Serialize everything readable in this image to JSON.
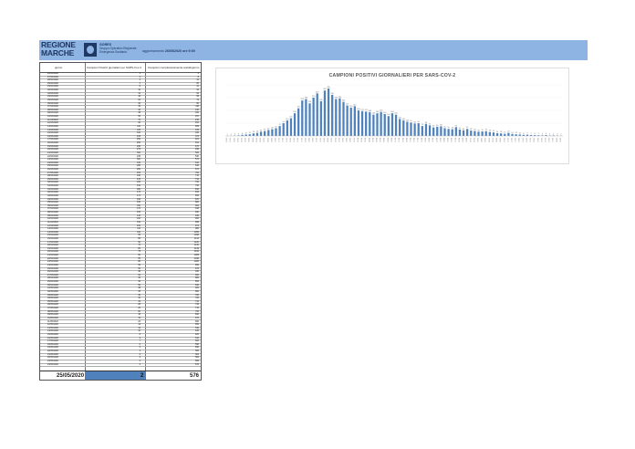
{
  "header": {
    "logo_line1": "REGIONE",
    "logo_line2": "MARCHE",
    "org_line1": "GORES",
    "org_line2": "Gruppo Operativo Regionale",
    "org_line3": "Emergenza Sanitaria",
    "updated_label": "aggiornamento",
    "updated_value": "26/05/2020 ore 9:00"
  },
  "table": {
    "columns": [
      "giorno",
      "Campioni Positivi giornalieri per SARS-Cov-2",
      "Campioni complessivamente testati/giorno"
    ],
    "rows": [
      [
        "26/02/2020",
        "1",
        "3"
      ],
      [
        "27/02/2020",
        "2",
        "8"
      ],
      [
        "28/02/2020",
        "3",
        "12"
      ],
      [
        "29/02/2020",
        "4",
        "20"
      ],
      [
        "01/03/2020",
        "8",
        "31"
      ],
      [
        "02/03/2020",
        "10",
        "43"
      ],
      [
        "03/03/2020",
        "12",
        "52"
      ],
      [
        "04/03/2020",
        "18",
        "68"
      ],
      [
        "05/03/2020",
        "22",
        "79"
      ],
      [
        "06/03/2020",
        "30",
        "95"
      ],
      [
        "07/03/2020",
        "35",
        "118"
      ],
      [
        "08/03/2020",
        "42",
        "130"
      ],
      [
        "09/03/2020",
        "48",
        "160"
      ],
      [
        "10/03/2020",
        "55",
        "197"
      ],
      [
        "11/03/2020",
        "70",
        "210"
      ],
      [
        "12/03/2020",
        "90",
        "252"
      ],
      [
        "13/03/2020",
        "110",
        "289"
      ],
      [
        "14/03/2020",
        "125",
        "315"
      ],
      [
        "15/03/2020",
        "160",
        "340"
      ],
      [
        "16/03/2020",
        "195",
        "372"
      ],
      [
        "17/03/2020",
        "250",
        "421"
      ],
      [
        "18/03/2020",
        "260",
        "452"
      ],
      [
        "19/03/2020",
        "230",
        "470"
      ],
      [
        "20/03/2020",
        "270",
        "498"
      ],
      [
        "21/03/2020",
        "300",
        "520"
      ],
      [
        "22/03/2020",
        "245",
        "530"
      ],
      [
        "23/03/2020",
        "320",
        "576"
      ],
      [
        "24/03/2020",
        "335",
        "610"
      ],
      [
        "25/03/2020",
        "290",
        "640"
      ],
      [
        "26/03/2020",
        "260",
        "672"
      ],
      [
        "27/03/2020",
        "265",
        "700"
      ],
      [
        "28/03/2020",
        "240",
        "715"
      ],
      [
        "29/03/2020",
        "215",
        "742"
      ],
      [
        "30/03/2020",
        "200",
        "760"
      ],
      [
        "31/03/2020",
        "210",
        "790"
      ],
      [
        "01/04/2020",
        "180",
        "810"
      ],
      [
        "02/04/2020",
        "175",
        "833"
      ],
      [
        "03/04/2020",
        "172",
        "850"
      ],
      [
        "04/04/2020",
        "168",
        "870"
      ],
      [
        "05/04/2020",
        "150",
        "880"
      ],
      [
        "06/04/2020",
        "160",
        "902"
      ],
      [
        "07/04/2020",
        "170",
        "918"
      ],
      [
        "08/04/2020",
        "155",
        "930"
      ],
      [
        "09/04/2020",
        "140",
        "945"
      ],
      [
        "10/04/2020",
        "160",
        "960"
      ],
      [
        "11/04/2020",
        "150",
        "968"
      ],
      [
        "12/04/2020",
        "120",
        "972"
      ],
      [
        "13/04/2020",
        "110",
        "980"
      ],
      [
        "14/04/2020",
        "100",
        "1050"
      ],
      [
        "15/04/2020",
        "95",
        "1098"
      ],
      [
        "16/04/2020",
        "88",
        "1112"
      ],
      [
        "17/04/2020",
        "90",
        "1120"
      ],
      [
        "18/04/2020",
        "70",
        "1130"
      ],
      [
        "19/04/2020",
        "85",
        "1149"
      ],
      [
        "20/04/2020",
        "75",
        "1160"
      ],
      [
        "21/04/2020",
        "60",
        "1085"
      ],
      [
        "22/04/2020",
        "65",
        "1040"
      ],
      [
        "23/04/2020",
        "68",
        "1020"
      ],
      [
        "24/04/2020",
        "55",
        "990"
      ],
      [
        "25/04/2020",
        "50",
        "970"
      ],
      [
        "26/04/2020",
        "48",
        "930"
      ],
      [
        "27/04/2020",
        "62",
        "900"
      ],
      [
        "28/04/2020",
        "45",
        "880"
      ],
      [
        "29/04/2020",
        "40",
        "860"
      ],
      [
        "30/04/2020",
        "50",
        "846"
      ],
      [
        "01/05/2020",
        "38",
        "820"
      ],
      [
        "02/05/2020",
        "35",
        "800"
      ],
      [
        "03/05/2020",
        "30",
        "780"
      ],
      [
        "04/05/2020",
        "32",
        "760"
      ],
      [
        "05/05/2020",
        "34",
        "744"
      ],
      [
        "06/05/2020",
        "28",
        "730"
      ],
      [
        "07/05/2020",
        "25",
        "715"
      ],
      [
        "08/05/2020",
        "20",
        "700"
      ],
      [
        "09/05/2020",
        "18",
        "690"
      ],
      [
        "10/05/2020",
        "15",
        "670"
      ],
      [
        "11/05/2020",
        "22",
        "660"
      ],
      [
        "12/05/2020",
        "14",
        "650"
      ],
      [
        "13/05/2020",
        "12",
        "640"
      ],
      [
        "14/05/2020",
        "10",
        "630"
      ],
      [
        "15/05/2020",
        "8",
        "620"
      ],
      [
        "16/05/2020",
        "9",
        "610"
      ],
      [
        "17/05/2020",
        "7",
        "600"
      ],
      [
        "18/05/2020",
        "6",
        "598"
      ],
      [
        "19/05/2020",
        "5",
        "590"
      ],
      [
        "20/05/2020",
        "4",
        "586"
      ],
      [
        "21/05/2020",
        "6",
        "584"
      ],
      [
        "22/05/2020",
        "3",
        "582"
      ],
      [
        "23/05/2020",
        "4",
        "580"
      ],
      [
        "24/05/2020",
        "3",
        "578"
      ]
    ],
    "total_label": "25/05/2020",
    "total_positive": "2",
    "total_tested": "576"
  },
  "chart_data": {
    "type": "bar",
    "title": "CAMPIONI POSITIVI GIORNALIERI PER SARS-COV-2",
    "categories": [
      "26/02",
      "27/02",
      "28/02",
      "29/02",
      "01/03",
      "02/03",
      "03/03",
      "04/03",
      "05/03",
      "06/03",
      "07/03",
      "08/03",
      "09/03",
      "10/03",
      "11/03",
      "12/03",
      "13/03",
      "14/03",
      "15/03",
      "16/03",
      "17/03",
      "18/03",
      "19/03",
      "20/03",
      "21/03",
      "22/03",
      "23/03",
      "24/03",
      "25/03",
      "26/03",
      "27/03",
      "28/03",
      "29/03",
      "30/03",
      "31/03",
      "01/04",
      "02/04",
      "03/04",
      "04/04",
      "05/04",
      "06/04",
      "07/04",
      "08/04",
      "09/04",
      "10/04",
      "11/04",
      "12/04",
      "13/04",
      "14/04",
      "15/04",
      "16/04",
      "17/04",
      "18/04",
      "19/04",
      "20/04",
      "21/04",
      "22/04",
      "23/04",
      "24/04",
      "25/04",
      "26/04",
      "27/04",
      "28/04",
      "29/04",
      "30/04",
      "01/05",
      "02/05",
      "03/05",
      "04/05",
      "05/05",
      "06/05",
      "07/05",
      "08/05",
      "09/05",
      "10/05",
      "11/05",
      "12/05",
      "13/05",
      "14/05",
      "15/05",
      "16/05",
      "17/05",
      "18/05",
      "19/05",
      "20/05",
      "21/05",
      "22/05",
      "23/05",
      "24/05",
      "25/05"
    ],
    "values": [
      1,
      2,
      3,
      4,
      8,
      10,
      12,
      18,
      22,
      30,
      35,
      42,
      48,
      55,
      70,
      90,
      110,
      125,
      160,
      195,
      250,
      260,
      230,
      270,
      300,
      245,
      320,
      335,
      290,
      260,
      265,
      240,
      215,
      200,
      210,
      180,
      175,
      172,
      168,
      150,
      160,
      170,
      155,
      140,
      160,
      150,
      120,
      110,
      100,
      95,
      88,
      90,
      70,
      85,
      75,
      60,
      65,
      68,
      55,
      50,
      48,
      62,
      45,
      40,
      50,
      38,
      35,
      30,
      32,
      34,
      28,
      25,
      20,
      18,
      15,
      22,
      14,
      12,
      10,
      8,
      9,
      7,
      6,
      5,
      4,
      6,
      3,
      4,
      3,
      2
    ],
    "ylim": [
      0,
      360
    ],
    "bar_color": "#4f81bd",
    "grid": true
  }
}
